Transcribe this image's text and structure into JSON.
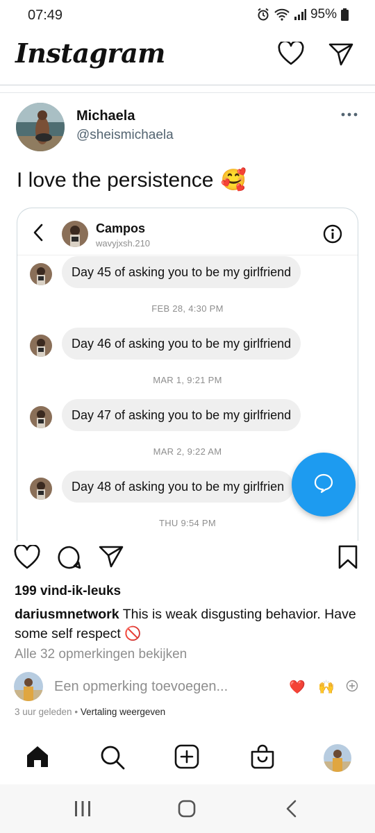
{
  "status_bar": {
    "time": "07:49",
    "battery": "95%"
  },
  "instagram": {
    "logo": "Instagram"
  },
  "tweet": {
    "author_name": "Michaela",
    "author_handle": "@sheismichaela",
    "text": "I love the persistence",
    "emoji": "🥰"
  },
  "dm": {
    "contact_name": "Campos",
    "contact_username": "wavyjxsh.210",
    "messages": [
      {
        "text": "Day 45 of asking you to be my girlfriend",
        "time_after": "FEB 28, 4:30 PM"
      },
      {
        "text": "Day 46 of asking you to be my girlfriend",
        "time_after": "MAR 1, 9:21 PM"
      },
      {
        "text": "Day 47 of asking you to be my girlfriend",
        "time_after": "MAR 2, 9:22 AM"
      },
      {
        "text": "Day 48 of asking you to be my girlfrien",
        "time_after": "THU 9:54 PM"
      }
    ]
  },
  "post": {
    "likes": "199 vind-ik-leuks",
    "caption_user": "dariusmnetwork",
    "caption_text": "This is weak disgusting behavior. Have some self respect",
    "caption_emoji": "🚫",
    "view_comments": "Alle 32 opmerkingen bekijken",
    "comment_placeholder": "Een opmerking toevoegen...",
    "quick_emojis": [
      "❤️",
      "🙌"
    ],
    "timestamp": "3 uur geleden",
    "separator": "•",
    "translate": "Vertaling weergeven"
  },
  "icons": {
    "status": [
      "alarm-icon",
      "wifi-icon",
      "signal-icon",
      "battery-icon"
    ],
    "header": [
      "heart-icon",
      "send-icon"
    ],
    "actions": [
      "like-icon",
      "comment-icon",
      "share-icon",
      "bookmark-icon"
    ],
    "nav": [
      "home-icon",
      "search-icon",
      "create-icon",
      "shop-icon",
      "profile-avatar"
    ],
    "system": [
      "recents-icon",
      "home-button-icon",
      "back-icon"
    ]
  },
  "colors": {
    "twitter_blue": "#1d9bf0",
    "bubble": "#efefef",
    "muted": "#8e8e8e"
  }
}
